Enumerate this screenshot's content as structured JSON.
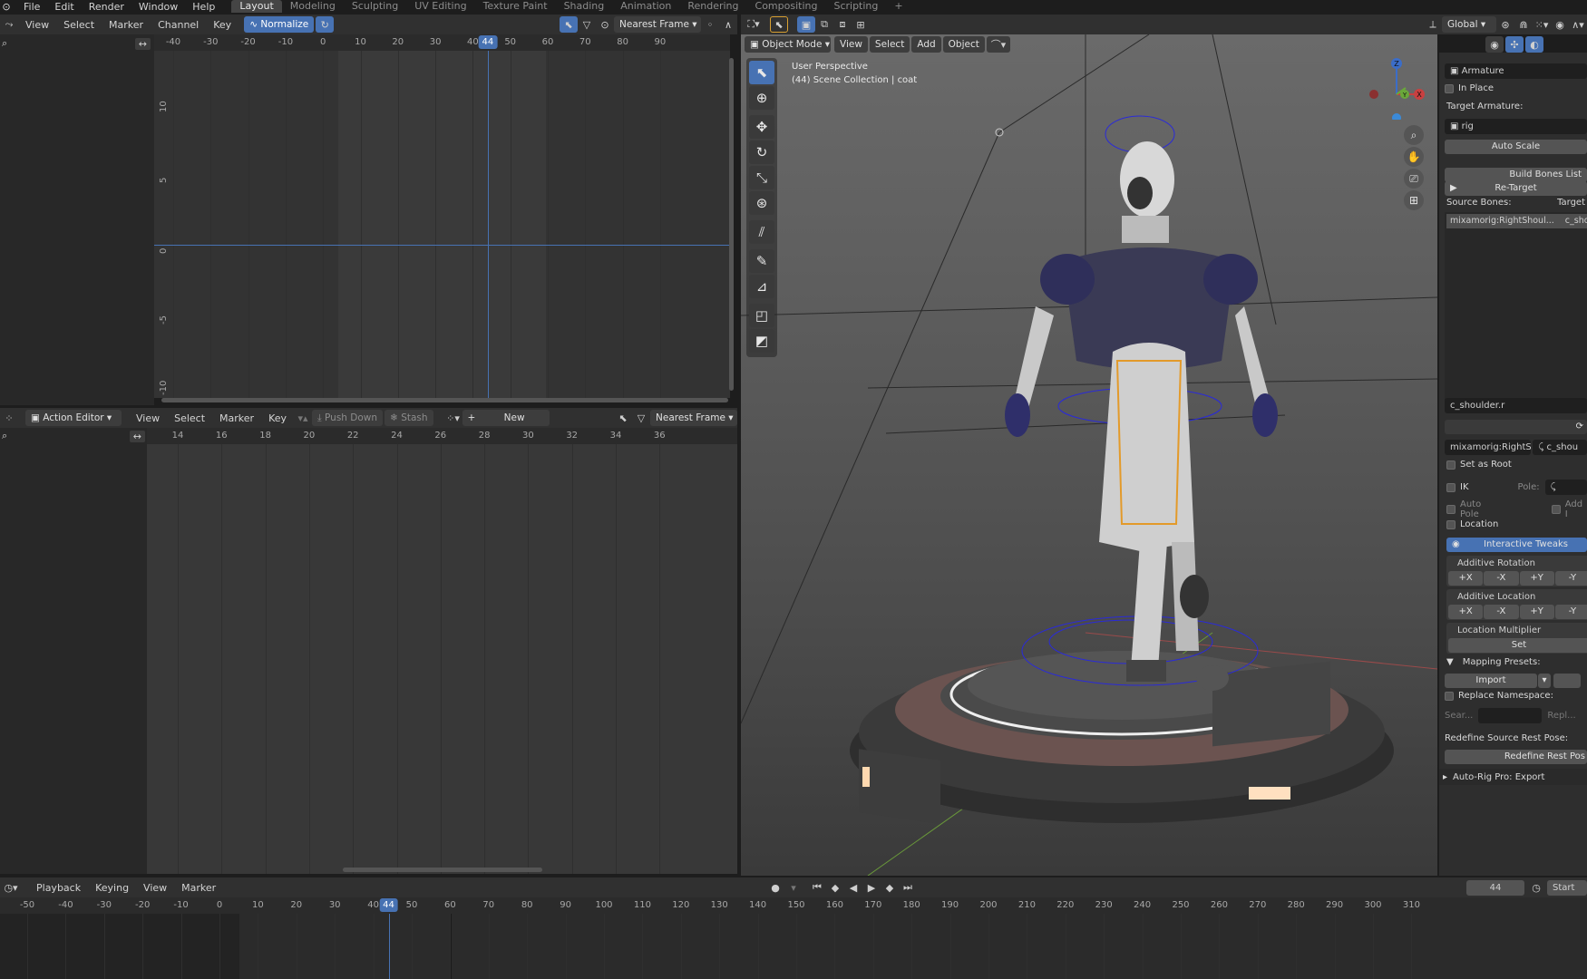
{
  "topbar": {
    "menus": [
      "File",
      "Edit",
      "Render",
      "Window",
      "Help"
    ],
    "workspaces": [
      "Layout",
      "Modeling",
      "Sculpting",
      "UV Editing",
      "Texture Paint",
      "Shading",
      "Animation",
      "Rendering",
      "Compositing",
      "Scripting"
    ],
    "active_workspace": "Layout",
    "add_tab": "+"
  },
  "graph_editor": {
    "menus": [
      "View",
      "Select",
      "Marker",
      "Channel",
      "Key"
    ],
    "normalize": "Normalize",
    "snap": "Nearest Frame",
    "ruler": [
      "-40",
      "-30",
      "-20",
      "-10",
      "0",
      "10",
      "20",
      "30",
      "40",
      "50",
      "60",
      "70",
      "80",
      "90"
    ],
    "current_frame": "44",
    "y_ticks": [
      "10",
      "5",
      "0",
      "-5",
      "-10"
    ]
  },
  "action_editor": {
    "mode": "Action Editor",
    "menus": [
      "View",
      "Select",
      "Marker",
      "Key"
    ],
    "push_down": "Push Down",
    "stash": "Stash",
    "new": "New",
    "snap": "Nearest Frame",
    "ruler": [
      "14",
      "16",
      "18",
      "20",
      "22",
      "24",
      "26",
      "28",
      "30",
      "32",
      "34",
      "36"
    ]
  },
  "viewport": {
    "orientation": "Global",
    "mode": "Object Mode",
    "menus": [
      "View",
      "Select",
      "Add",
      "Object"
    ],
    "overlay_line1": "User Perspective",
    "overlay_line2": "(44) Scene Collection | coat",
    "gizmo": {
      "x": "X",
      "y": "Y",
      "z": "Z"
    }
  },
  "sidebar": {
    "source_armature": "Armature",
    "in_place": "In Place",
    "target_armature_label": "Target Armature:",
    "target_armature": "rig",
    "auto_scale": "Auto Scale",
    "build_bones": "Build Bones List",
    "retarget": "Re-Target",
    "source_bones": "Source Bones:",
    "target": "Target",
    "bone_row_src": "mixamorig:RightShoul...",
    "bone_row_tgt": "c_shou",
    "bone_field": "c_shoulder.r",
    "mapping_src": "mixamorig:RightS...",
    "mapping_tgt": "c_shou",
    "set_as_root": "Set as Root",
    "ik": "IK",
    "pole": "Pole:",
    "auto_pole": "Auto Pole",
    "add_i": "Add I",
    "location": "Location",
    "interactive_tweaks": "Interactive Tweaks",
    "additive_rotation": "Additive Rotation",
    "axis_buttons": [
      "+X",
      "-X",
      "+Y",
      "-Y"
    ],
    "additive_location": "Additive Location",
    "location_multiplier": "Location Multiplier",
    "set": "Set",
    "mapping_presets": "Mapping Presets:",
    "import": "Import",
    "replace_namespace": "Replace Namespace:",
    "search_placeholder": "Sear...",
    "replace_placeholder": "Repl...",
    "redefine_label": "Redefine Source Rest Pose:",
    "redefine_btn": "Redefine Rest Pos",
    "export_panel": "Auto-Rig Pro: Export"
  },
  "timeline": {
    "menus": [
      "Playback",
      "Keying",
      "View",
      "Marker"
    ],
    "frame": "44",
    "start": "Start",
    "ruler": [
      "-50",
      "-40",
      "-30",
      "-20",
      "-10",
      "0",
      "10",
      "20",
      "30",
      "40",
      "50",
      "60",
      "70",
      "80",
      "90",
      "100",
      "110",
      "120",
      "130",
      "140",
      "150",
      "160",
      "170",
      "180",
      "190",
      "200",
      "210",
      "220",
      "230",
      "240",
      "250",
      "260",
      "270",
      "280",
      "290",
      "300",
      "310"
    ],
    "current_frame": "44"
  }
}
